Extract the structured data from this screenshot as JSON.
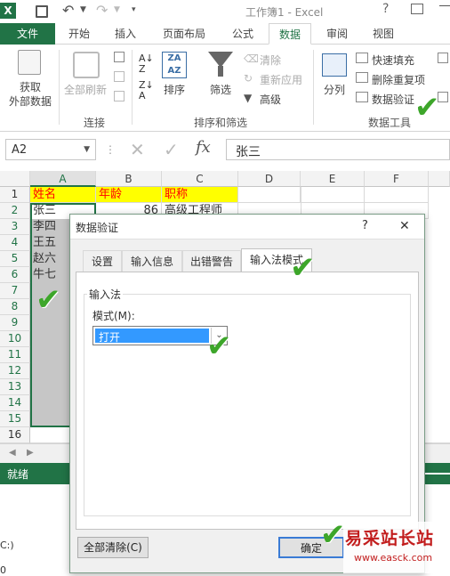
{
  "window": {
    "title": "工作簿1 - Excel"
  },
  "ribbon_tabs": [
    "文件",
    "开始",
    "插入",
    "页面布局",
    "公式",
    "数据",
    "审阅",
    "视图"
  ],
  "ribbon": {
    "get_data": "获取\n外部数据",
    "refresh_all": "全部刷新",
    "connections_group": "连接",
    "sort_label": "排序",
    "filter_label": "筛选",
    "clear_label": "清除",
    "reapply_label": "重新应用",
    "advanced_label": "高级",
    "sort_filter_group": "排序和筛选",
    "split_label": "分列",
    "flash_fill": "快速填充",
    "remove_dup": "删除重复项",
    "data_validation": "数据验证",
    "data_tools_group": "数据工具"
  },
  "formula_bar": {
    "name_box": "A2",
    "fx": "fx",
    "value": "张三"
  },
  "columns": [
    "A",
    "B",
    "C",
    "D",
    "E",
    "F"
  ],
  "rows": [
    "1",
    "2",
    "3",
    "4",
    "5",
    "6",
    "7",
    "8",
    "9",
    "10",
    "11",
    "12",
    "13",
    "14",
    "15",
    "16"
  ],
  "cells": {
    "header": [
      "姓名",
      "年龄",
      "职称"
    ],
    "names": [
      "张三",
      "李四",
      "王五",
      "赵六",
      "牛七"
    ],
    "b2": "86",
    "c2": "高级工程师"
  },
  "status": {
    "ready": "就绪"
  },
  "dialog": {
    "title": "数据验证",
    "help": "?",
    "close": "✕",
    "tabs": [
      "设置",
      "输入信息",
      "出错警告",
      "输入法模式"
    ],
    "section": "输入法",
    "mode_label": "模式(M):",
    "mode_value": "打开",
    "clear_all": "全部清除(C)",
    "ok": "确定"
  },
  "bottom_left_text": "C:)",
  "bottom_left_text2": "0",
  "watermark": {
    "text": "易采站长站",
    "url": "www.easck.com"
  },
  "colors": {
    "excel_green": "#217346",
    "header_yellow": "#ffff00",
    "header_text": "#ff0000",
    "selected_input": "#3399ff"
  }
}
